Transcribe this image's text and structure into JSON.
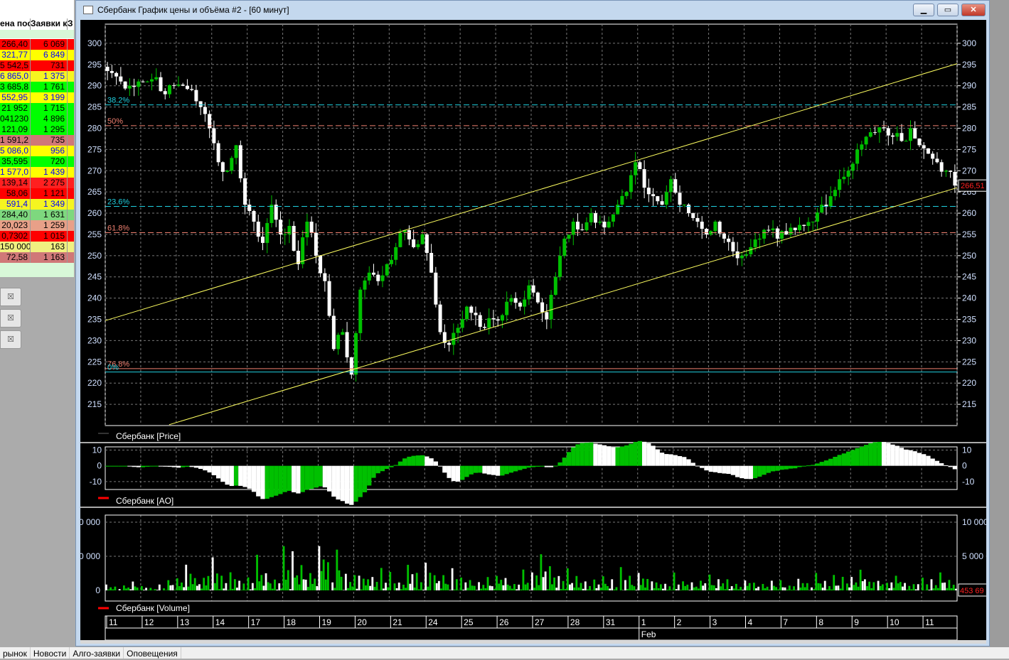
{
  "window": {
    "title": "Сбербанк График цены и объёма #2 - [60 минут]",
    "minimize": "▁",
    "maximize": "▭",
    "close": "✕"
  },
  "table": {
    "headers": [
      "ена пос",
      "Заявки к",
      "З"
    ],
    "rows": [
      {
        "price": "266,40",
        "orders": "6 069",
        "bg": "#ff0000",
        "fg": "#000"
      },
      {
        "price": "321,77",
        "orders": "6 849",
        "bg": "#ffff00",
        "fg": "#0000ff"
      },
      {
        "price": "5 542,5",
        "orders": "731",
        "bg": "#ff0000",
        "fg": "#000"
      },
      {
        "price": "6 865,0",
        "orders": "1 375",
        "bg": "#f5f520",
        "fg": "#0000ff"
      },
      {
        "price": "3 685,8",
        "orders": "1 761",
        "bg": "#00ff00",
        "fg": "#000"
      },
      {
        "price": "552,95",
        "orders": "3 199",
        "bg": "#ffff00",
        "fg": "#0000ff"
      },
      {
        "price": "21 952",
        "orders": "1 715",
        "bg": "#00ff00",
        "fg": "#000"
      },
      {
        "price": "041230",
        "orders": "4 896",
        "bg": "#00ff00",
        "fg": "#000"
      },
      {
        "price": "121,09",
        "orders": "1 295",
        "bg": "#00ff00",
        "fg": "#000"
      },
      {
        "price": "1 591,2",
        "orders": "735",
        "bg": "#d07878",
        "fg": "#000"
      },
      {
        "price": "5 086,0",
        "orders": "956",
        "bg": "#ffff00",
        "fg": "#0000ff"
      },
      {
        "price": "35,595",
        "orders": "720",
        "bg": "#00ff00",
        "fg": "#000"
      },
      {
        "price": "1 577,0",
        "orders": "1 439",
        "bg": "#ffff00",
        "fg": "#0000ff"
      },
      {
        "price": "139,14",
        "orders": "2 275",
        "bg": "#ff2020",
        "fg": "#000"
      },
      {
        "price": "58,06",
        "orders": "1 121",
        "bg": "#ff0000",
        "fg": "#000"
      },
      {
        "price": "591,4",
        "orders": "1 349",
        "bg": "#f5f520",
        "fg": "#0000ff"
      },
      {
        "price": "284,40",
        "orders": "1 631",
        "bg": "#7ed87e",
        "fg": "#000"
      },
      {
        "price": "20,023",
        "orders": "1 259",
        "bg": "#e8a088",
        "fg": "#000"
      },
      {
        "price": "0,7302",
        "orders": "1 015",
        "bg": "#ff0000",
        "fg": "#000"
      },
      {
        "price": "150 000",
        "orders": "163",
        "bg": "#f0f080",
        "fg": "#000"
      },
      {
        "price": "72,58",
        "orders": "1 163",
        "bg": "#d07878",
        "fg": "#000"
      }
    ]
  },
  "side_buttons": [
    "☒",
    "☒",
    "☒"
  ],
  "bottom_tabs": [
    "рынок",
    "Новости",
    "Алго-заявки",
    "Оповещения"
  ],
  "colors": {
    "up": "#00c000",
    "down": "#ffffff",
    "trend": "#ffff60",
    "fib_cyan": "#20d0e0",
    "fib_red": "#f08070",
    "axis_text": "#d0e0ff",
    "last_price": "#ff2020"
  },
  "chart_data": [
    {
      "type": "candlestick",
      "legend": "Сбербанк [Price]",
      "ylim": [
        210,
        304.5
      ],
      "yticks": [
        215,
        220,
        225,
        230,
        235,
        240,
        245,
        250,
        255,
        260,
        265,
        270,
        275,
        280,
        285,
        290,
        295,
        300
      ],
      "days": [
        "11",
        "12",
        "13",
        "14",
        "17",
        "18",
        "19",
        "20",
        "21",
        "24",
        "25",
        "26",
        "27",
        "28",
        "31",
        "1",
        "2",
        "3",
        "4",
        "7",
        "8",
        "9",
        "10",
        "11"
      ],
      "month_label": "Feb",
      "closes": [
        [
          293,
          291,
          290,
          291
        ],
        [
          291,
          292,
          288,
          290
        ],
        [
          290,
          289,
          285,
          280
        ],
        [
          272,
          270,
          276,
          262
        ],
        [
          258,
          253,
          262,
          255
        ],
        [
          257,
          248,
          258,
          250
        ],
        [
          244,
          228,
          232,
          222
        ],
        [
          242,
          246,
          244,
          248
        ],
        [
          252,
          256,
          252,
          255
        ],
        [
          246,
          232,
          229,
          233
        ],
        [
          238,
          236,
          233,
          235
        ],
        [
          236,
          240,
          238,
          243
        ],
        [
          239,
          235,
          245,
          254
        ],
        [
          258,
          256,
          260,
          258
        ],
        [
          258,
          262,
          265,
          272
        ],
        [
          266,
          264,
          262,
          268
        ],
        [
          262,
          260,
          258,
          255
        ],
        [
          258,
          254,
          251,
          250
        ],
        [
          252,
          254,
          256,
          254
        ],
        [
          255,
          256,
          257,
          258
        ],
        [
          262,
          264,
          268,
          270
        ],
        [
          275,
          278,
          279,
          280
        ],
        [
          278,
          277,
          280,
          276
        ],
        [
          274,
          272,
          270,
          266.5
        ]
      ],
      "last_price_label": "266,51",
      "fib_levels": [
        {
          "label": "38.2%",
          "value": 285.5,
          "color": "cyan"
        },
        {
          "label": "50%",
          "value": 280.6,
          "color": "red"
        },
        {
          "label": "23.6%",
          "value": 261.6,
          "color": "cyan"
        },
        {
          "label": "61.8%",
          "value": 255.4,
          "color": "red"
        },
        {
          "label": "76.8%",
          "value": 223.4,
          "color": "red"
        },
        {
          "label": "0%",
          "value": 222.6,
          "color": "cyan"
        }
      ],
      "trend_lines": [
        {
          "from": [
            "11",
            234.7
          ],
          "to": [
            "11 Feb end",
            295.2
          ]
        },
        {
          "from": [
            "12",
            210.2
          ],
          "to": [
            "11 Feb end",
            266
          ]
        }
      ],
      "grid": true
    },
    {
      "type": "bar",
      "legend": "Сбербанк [AO]",
      "ylim": [
        -15,
        12
      ],
      "yticks": [
        10,
        0,
        -10
      ]
    },
    {
      "type": "bar",
      "legend": "Сбербанк [Volume]",
      "ylim": [
        0,
        11000
      ],
      "yticks": [
        "0",
        "5 000 0",
        "10 000"
      ],
      "left_yticks": [
        "0",
        "0 000",
        "0 000"
      ],
      "last_label": "453 69",
      "volume": [
        [
          800,
          600,
          900,
          1200
        ],
        [
          700,
          500,
          800,
          1500
        ],
        [
          2500,
          4500,
          1800,
          3500
        ],
        [
          6200,
          3000,
          4500,
          2000
        ],
        [
          3500,
          7500,
          2500,
          1800
        ],
        [
          10000,
          6500,
          4000,
          3000
        ],
        [
          8800,
          3800,
          5500,
          2500
        ],
        [
          4000,
          3000,
          2500,
          3500
        ],
        [
          3000,
          2000,
          4500,
          3800
        ],
        [
          5500,
          3500,
          2500,
          3000
        ],
        [
          2500,
          2000,
          1500,
          2000
        ],
        [
          3200,
          2000,
          1800,
          3000
        ],
        [
          4500,
          5500,
          3500,
          2500
        ],
        [
          3500,
          2000,
          1500,
          2000
        ],
        [
          2200,
          1500,
          3500,
          2000
        ],
        [
          3800,
          2500,
          1800,
          1500
        ],
        [
          3000,
          2000,
          1500,
          1800
        ],
        [
          2500,
          1800,
          2000,
          1500
        ],
        [
          1800,
          1500,
          1200,
          1600
        ],
        [
          1500,
          1200,
          1800,
          1400
        ],
        [
          2500,
          1800,
          2200,
          2800
        ],
        [
          2500,
          3000,
          2000,
          1800
        ],
        [
          2200,
          3500,
          2000,
          1800
        ],
        [
          1800,
          1500,
          3200,
          1400
        ]
      ]
    }
  ]
}
